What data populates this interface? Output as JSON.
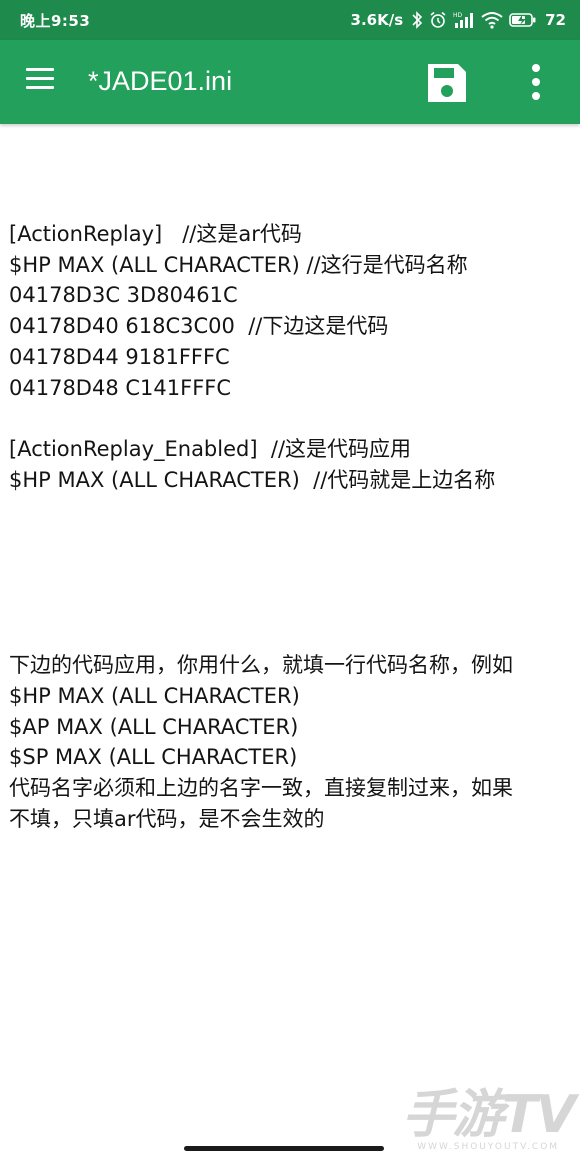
{
  "status_bar": {
    "time": "晚上9:53",
    "net_speed": "3.6K/s",
    "battery_percent": "72",
    "icons": [
      "bluetooth-icon",
      "alarm-icon",
      "hd-signal-icon",
      "wifi-icon",
      "battery-charging-icon"
    ]
  },
  "app_bar": {
    "menu_icon": "hamburger-menu-icon",
    "title": "*JADE01.ini",
    "save_icon": "floppy-disk-save-icon",
    "more_icon": "more-vertical-icon",
    "color": "#23a05b"
  },
  "editor": {
    "lines": [
      "",
      "[ActionReplay]   //这是ar代码",
      "$HP MAX (ALL CHARACTER) //这行是代码名称",
      "04178D3C 3D80461C",
      "04178D40 618C3C00  //下边这是代码",
      "04178D44 9181FFFC",
      "04178D48 C141FFFC",
      "",
      "[ActionReplay_Enabled]  //这是代码应用",
      "$HP MAX (ALL CHARACTER)  //代码就是上边名称",
      "",
      "",
      "",
      "",
      "",
      "下边的代码应用，你用什么，就填一行代码名称，例如",
      "$HP MAX (ALL CHARACTER)",
      "$AP MAX (ALL CHARACTER)",
      "$SP MAX (ALL CHARACTER)",
      "代码名字必须和上边的名字一致，直接复制过来，如果",
      "不填，只填ar代码，是不会生效的"
    ]
  },
  "watermark": {
    "main": "手游TV",
    "sub": "WWW.SHOUYOUTV.COM"
  }
}
